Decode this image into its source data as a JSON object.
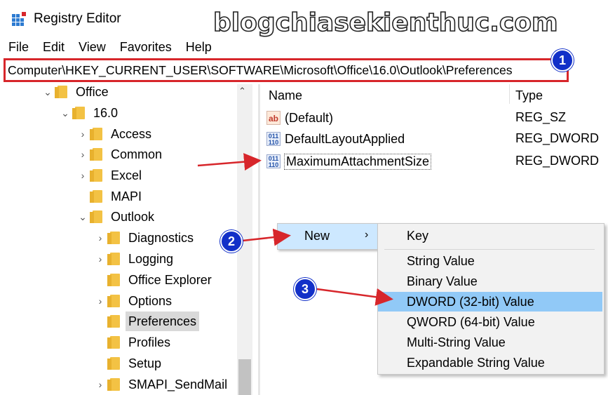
{
  "window": {
    "title": "Registry Editor",
    "watermark": "blogchiasekienthuc.com"
  },
  "menu": [
    "File",
    "Edit",
    "View",
    "Favorites",
    "Help"
  ],
  "address": "Computer\\HKEY_CURRENT_USER\\SOFTWARE\\Microsoft\\Office\\16.0\\Outlook\\Preferences",
  "badges": [
    "1",
    "2",
    "3"
  ],
  "tree": [
    {
      "label": "Office",
      "expander": "⌄"
    },
    {
      "label": "16.0",
      "expander": "⌄"
    },
    {
      "label": "Access",
      "expander": "›"
    },
    {
      "label": "Common",
      "expander": "›"
    },
    {
      "label": "Excel",
      "expander": "›"
    },
    {
      "label": "MAPI",
      "expander": ""
    },
    {
      "label": "Outlook",
      "expander": "⌄"
    },
    {
      "label": "Diagnostics",
      "expander": "›"
    },
    {
      "label": "Logging",
      "expander": "›"
    },
    {
      "label": "Office Explorer",
      "expander": ""
    },
    {
      "label": "Options",
      "expander": "›"
    },
    {
      "label": "Preferences",
      "expander": ""
    },
    {
      "label": "Profiles",
      "expander": ""
    },
    {
      "label": "Setup",
      "expander": ""
    },
    {
      "label": "SMAPI_SendMail",
      "expander": "›"
    }
  ],
  "columns": {
    "name": "Name",
    "type": "Type"
  },
  "values": [
    {
      "name": "(Default)",
      "type": "REG_SZ",
      "icon": "ab"
    },
    {
      "name": "DefaultLayoutApplied",
      "type": "REG_DWORD",
      "icon": "011\n110"
    },
    {
      "name": "MaximumAttachmentSize",
      "type": "REG_DWORD",
      "icon": "011\n110"
    }
  ],
  "context_menu": {
    "new_label": "New",
    "new_arrow": "›"
  },
  "submenu": [
    "Key",
    "String Value",
    "Binary Value",
    "DWORD (32-bit) Value",
    "QWORD (64-bit) Value",
    "Multi-String Value",
    "Expandable String Value"
  ],
  "colors": {
    "highlight": "#91c9f7",
    "new_bg": "#cde8ff",
    "annotation_red": "#d7262b",
    "badge_blue": "#1230c8"
  }
}
